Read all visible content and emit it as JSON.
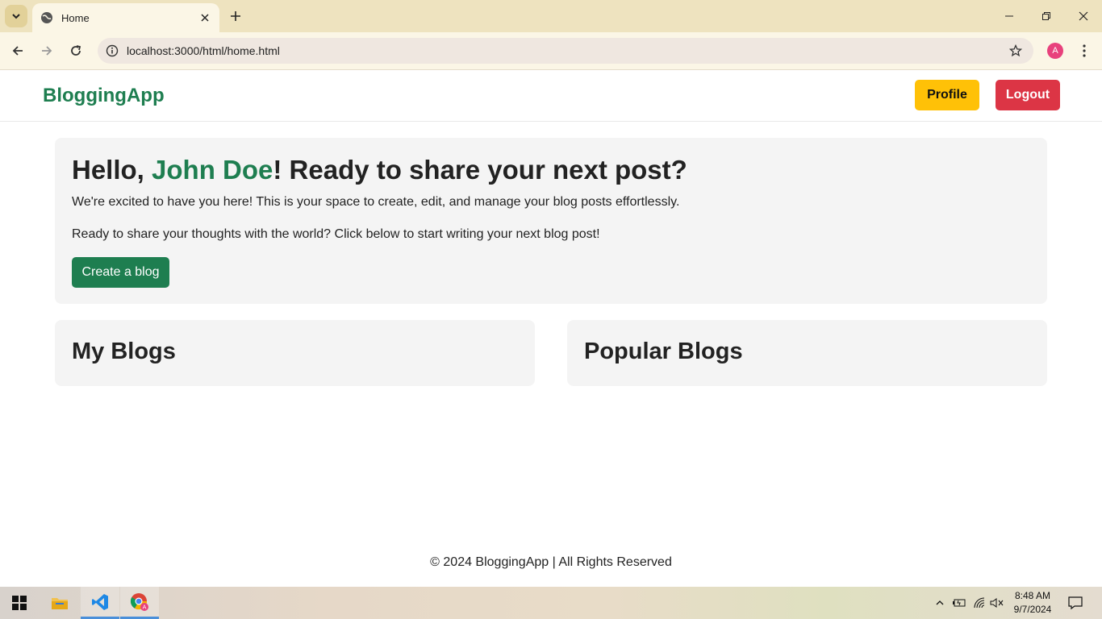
{
  "browser": {
    "tab_title": "Home",
    "url": "localhost:3000/html/home.html",
    "profile_initial": "A"
  },
  "navbar": {
    "brand": "BloggingApp",
    "profile_label": "Profile",
    "logout_label": "Logout"
  },
  "hero": {
    "greeting_prefix": "Hello, ",
    "user_name": "John Doe",
    "greeting_suffix": "! Ready to share your next post?",
    "intro": "We're excited to have you here! This is your space to create, edit, and manage your blog posts effortlessly.",
    "prompt": "Ready to share your thoughts with the world? Click below to start writing your next blog post!",
    "create_label": "Create a blog"
  },
  "sections": {
    "my_blogs": "My Blogs",
    "popular_blogs": "Popular Blogs"
  },
  "footer": {
    "text": "© 2024 BloggingApp | All Rights Reserved"
  },
  "taskbar": {
    "time": "8:48 AM",
    "date": "9/7/2024"
  },
  "colors": {
    "brand_green": "#1e7e50",
    "profile_yellow": "#ffc107",
    "logout_red": "#dc3545",
    "card_bg": "#f4f4f4"
  }
}
